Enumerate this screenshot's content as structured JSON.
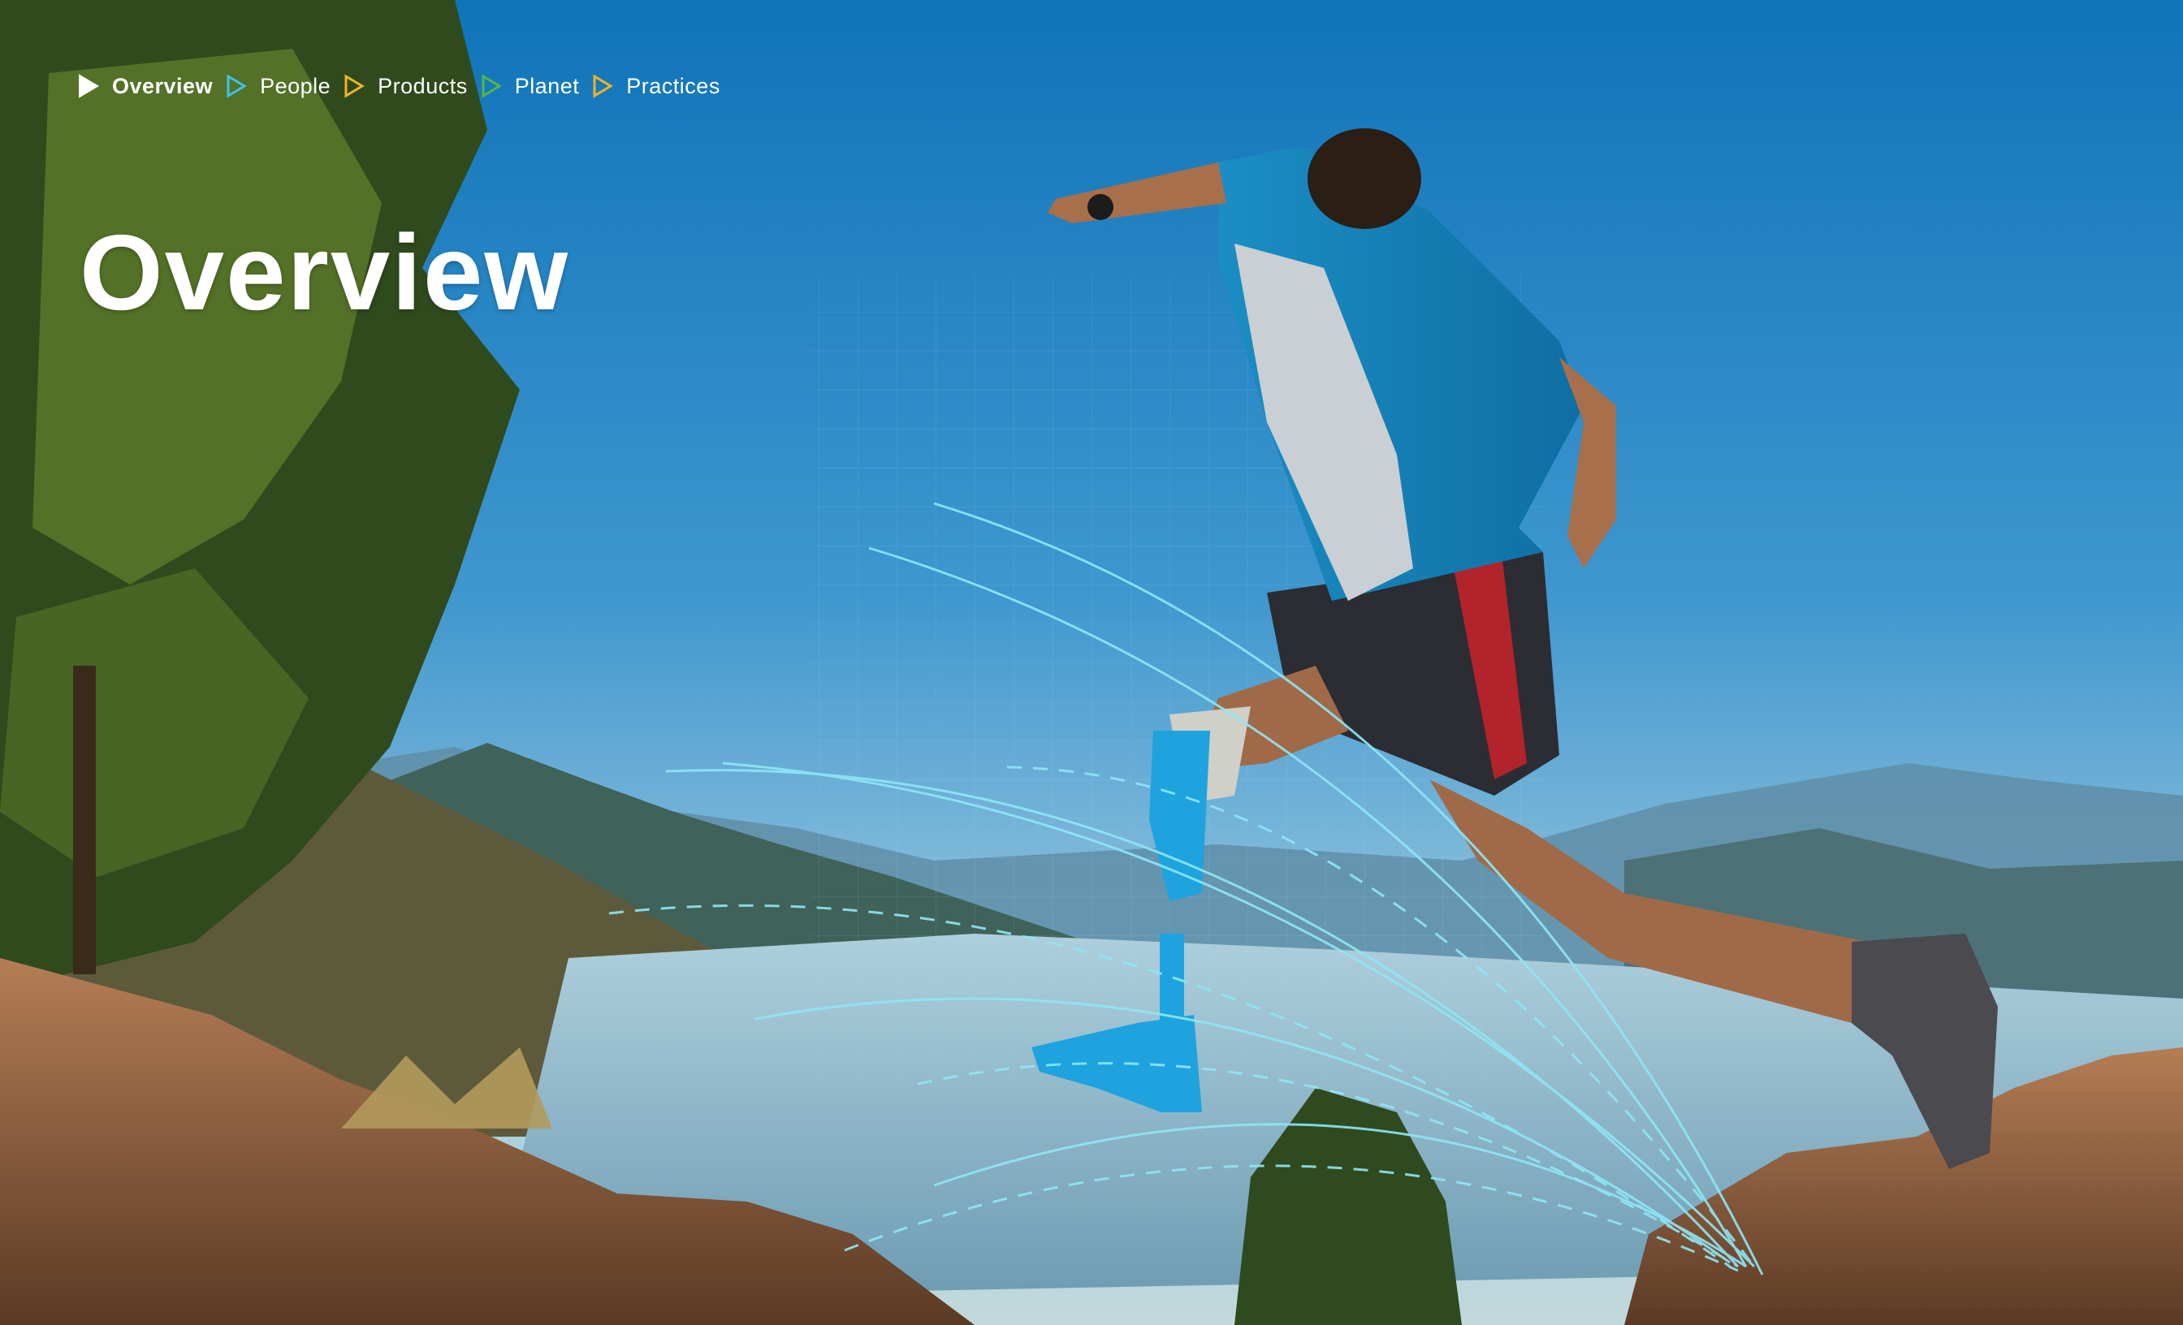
{
  "nav": {
    "items": [
      {
        "label": "Overview",
        "color": "#ffffff",
        "active": true
      },
      {
        "label": "People",
        "color": "#3fc1ea",
        "active": false
      },
      {
        "label": "Products",
        "color": "#f2b422",
        "active": false
      },
      {
        "label": "Planet",
        "color": "#55b648",
        "active": false
      },
      {
        "label": "Practices",
        "color": "#f2b422",
        "active": false
      }
    ]
  },
  "hero": {
    "title": "Overview"
  },
  "colors": {
    "sky_top": "#0f76b8",
    "sky_bottom": "#a9cfe0",
    "prosthetic": "#1ea3de",
    "motion_lines": "#8fe6f5"
  }
}
